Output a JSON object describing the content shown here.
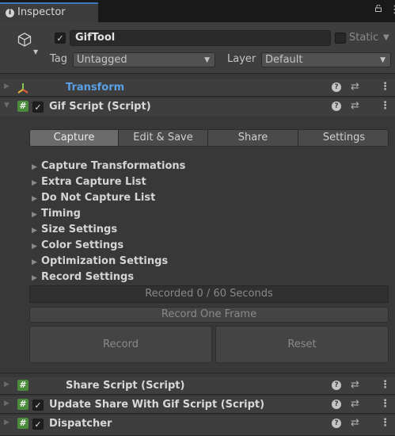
{
  "tab": {
    "label": "Inspector"
  },
  "header": {
    "object_name": "GifTool",
    "static_label": "Static",
    "tag_label": "Tag",
    "tag_value": "Untagged",
    "layer_label": "Layer",
    "layer_value": "Default"
  },
  "components": {
    "transform": "Transform",
    "gif_script": "Gif Script (Script)",
    "share_script": "Share Script (Script)",
    "update_share": "Update Share With Gif Script (Script)",
    "dispatcher": "Dispatcher"
  },
  "toolbar": {
    "tabs": [
      "Capture",
      "Edit & Save",
      "Share",
      "Settings"
    ],
    "active": "Capture"
  },
  "foldouts": [
    "Capture Transformations",
    "Extra Capture List",
    "Do Not Capture List",
    "Timing",
    "Size Settings",
    "Color Settings",
    "Optimization Settings",
    "Record Settings"
  ],
  "status_text": "Recorded 0 / 60 Seconds",
  "buttons": {
    "record_one_frame": "Record One Frame",
    "record": "Record",
    "reset": "Reset"
  },
  "colors": {
    "accent_tab": "#3a79bb",
    "script_icon": "#4a8c3c",
    "transform_title": "#5aa0e6"
  },
  "icons": [
    "info-icon",
    "lock-icon",
    "kebab-menu-icon",
    "gameobject-cube-icon",
    "checkbox-icon",
    "transform-axes-icon",
    "script-hash-icon",
    "help-icon",
    "preset-icon",
    "foldout-arrow-icon"
  ]
}
